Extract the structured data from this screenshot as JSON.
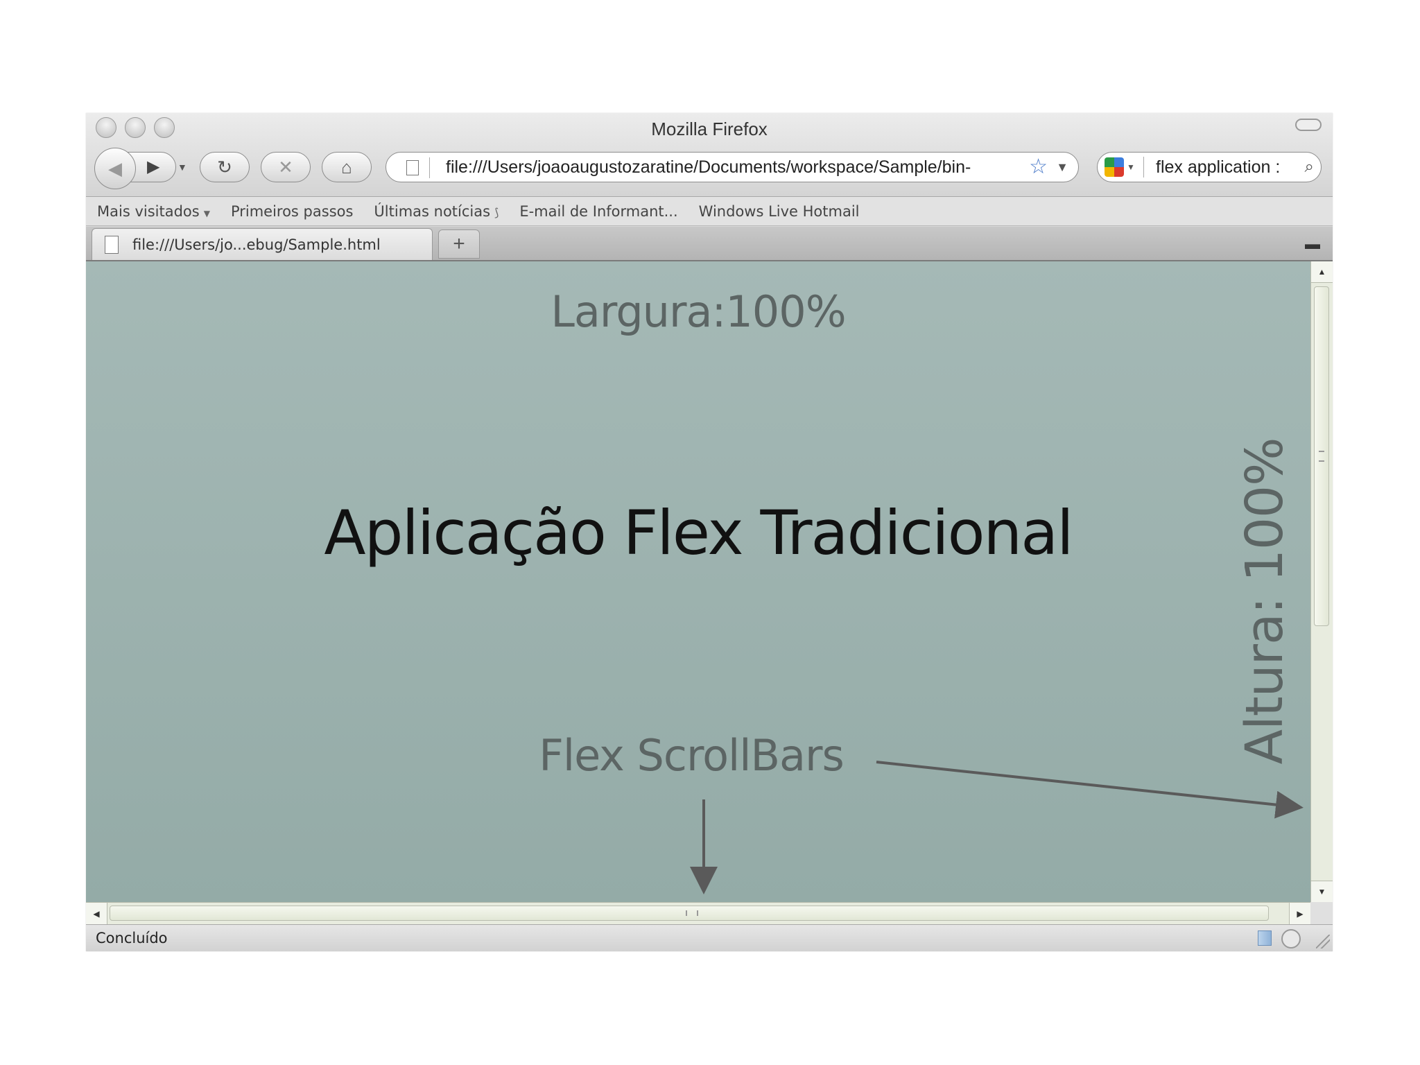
{
  "window": {
    "title": "Mozilla Firefox"
  },
  "navigation": {
    "back_glyph": "◀",
    "forward_glyph": "▶",
    "history_dropdown_glyph": "▼",
    "reload_glyph": "↻",
    "stop_glyph": "✕",
    "home_glyph": "⌂"
  },
  "urlbar": {
    "value": "file:///Users/joaoaugustozaratine/Documents/workspace/Sample/bin-",
    "star_glyph": "☆",
    "dropdown_glyph": "▼"
  },
  "searchbar": {
    "value": "flex application :",
    "search_glyph": "⌕"
  },
  "bookmarks": [
    {
      "label": "Mais visitados",
      "dropdown": "▼"
    },
    {
      "label": "Primeiros passos"
    },
    {
      "label": "Últimas notícias",
      "rss": "⟆"
    },
    {
      "label": "E-mail de Informant..."
    },
    {
      "label": "Windows Live Hotmail"
    }
  ],
  "tabs": [
    {
      "label": "file:///Users/jo...ebug/Sample.html"
    }
  ],
  "new_tab_glyph": "+",
  "content": {
    "width_label": "Largura:100%",
    "main_title": "Aplicação Flex Tradicional",
    "scrollbars_label": "Flex ScrollBars",
    "height_label": "Altura: 100%",
    "background_color": "#a0b4b0"
  },
  "statusbar": {
    "text": "Concluído"
  }
}
